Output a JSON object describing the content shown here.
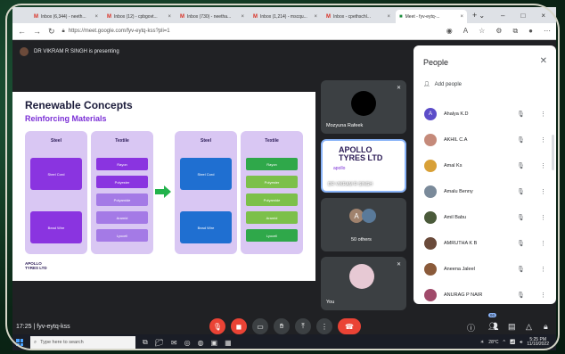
{
  "browser": {
    "tabs": [
      {
        "label": "Inbox (6,344) - neeth...",
        "active": false
      },
      {
        "label": "Inbox (12) - cpbgovt...",
        "active": false
      },
      {
        "label": "Inbox (730) - neetha...",
        "active": false
      },
      {
        "label": "Inbox (1,214) - mscqu...",
        "active": false
      },
      {
        "label": "Inbox - cpethschl...",
        "active": false
      },
      {
        "label": "Meet - fyv-eytq-...",
        "active": true
      }
    ],
    "new_tab": "+",
    "url": "https://meet.google.com/fyv-eytq-kss?pli=1"
  },
  "meet": {
    "presenting_text": "DR VIKRAM R SINGH is presenting",
    "slide": {
      "title": "Renewable Concepts",
      "subtitle": "Reinforcing Materials",
      "left_steel": "Steel",
      "left_textile": "Textile",
      "right_steel": "Steel",
      "right_textile": "Textile",
      "steel_items": [
        "Steel Cord",
        "Bead Wire"
      ],
      "textile_items": [
        "Rayon",
        "Polyester",
        "Polyamide",
        "Aramid",
        "Lyocell"
      ],
      "logo_line1": "APOLLO",
      "logo_line2": "TYRES LTD"
    },
    "tiles": [
      {
        "name": "Mozyuna Rafeek"
      },
      {
        "name": "DR VIKRAM R SINGH",
        "logo_line1": "APOLLO",
        "logo_line2": "TYRES LTD",
        "logo_small": "apollo"
      },
      {
        "name": "50 others",
        "avatar_letter": "A"
      },
      {
        "name": "You"
      }
    ],
    "meeting_time": "17:25",
    "meeting_code": "fyv-eytq-kss",
    "participant_count": "66"
  },
  "people_panel": {
    "title": "People",
    "add_people": "Add people",
    "participants": [
      {
        "name": "Ahalya K.D",
        "avatar": "A",
        "color": "#5c4dc9"
      },
      {
        "name": "AKHIL C.A",
        "avatar": "",
        "color": "#c58a7a"
      },
      {
        "name": "Amal Ks",
        "avatar": "",
        "color": "#d8a037"
      },
      {
        "name": "Amalu Benny",
        "avatar": "",
        "color": "#7a8a9a"
      },
      {
        "name": "Amil Babu",
        "avatar": "",
        "color": "#4a5a3a"
      },
      {
        "name": "AMRUTHA K B",
        "avatar": "",
        "color": "#6a4a3a"
      },
      {
        "name": "Aneena Jaleel",
        "avatar": "",
        "color": "#8a5a3a"
      },
      {
        "name": "ANURAG P NAIR",
        "avatar": "",
        "color": "#a04a6a"
      }
    ]
  },
  "taskbar": {
    "search_placeholder": "Type here to search",
    "weather": "28°C",
    "time": "5:25 PM",
    "date": "11/10/2022"
  },
  "colors": {
    "accent": "#1a73e8",
    "end_call": "#ea4335",
    "slide_purple": "#7b2fd6",
    "green_arrow": "#22b24c"
  }
}
